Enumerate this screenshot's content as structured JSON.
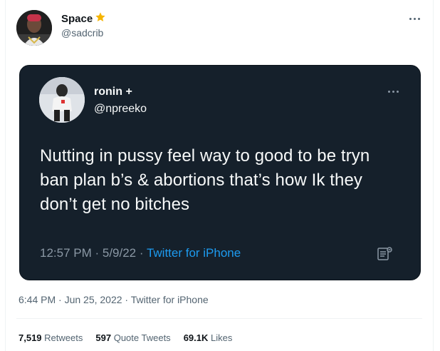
{
  "tweet": {
    "author": {
      "display_name": "Space",
      "badge_emoji": "⭐",
      "handle": "@sadcrib"
    },
    "timestamp": "6:44 PM · Jun 25, 2022 · Twitter for iPhone",
    "stats": {
      "retweets_count": "7,519",
      "retweets_label": "Retweets",
      "quotes_count": "597",
      "quotes_label": "Quote Tweets",
      "likes_count": "69.1K",
      "likes_label": "Likes"
    }
  },
  "quoted_tweet": {
    "author": {
      "display_name": "ronin +",
      "handle": "@npreeko"
    },
    "text": "Nutting in pussy feel way to good to be tryn ban plan b’s & abortions that’s how Ik they don’t get no bitches",
    "time": "12:57 PM · 5/9/22 · ",
    "source": "Twitter for iPhone"
  },
  "icons": {
    "more": "more-icon",
    "analytics": "analytics-icon"
  },
  "colors": {
    "card_bg": "#15202b",
    "link": "#1d9bf0",
    "muted": "#536471"
  }
}
